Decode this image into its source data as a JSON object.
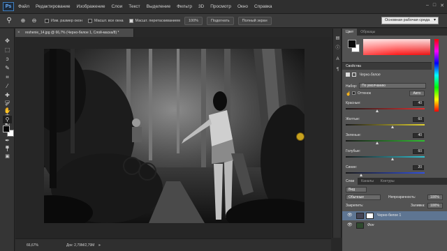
{
  "app": {
    "logo": "Ps",
    "menu": [
      "Файл",
      "Редактирование",
      "Изображение",
      "Слои",
      "Текст",
      "Выделение",
      "Фильтр",
      "3D",
      "Просмотр",
      "Окно",
      "Справка"
    ]
  },
  "window_controls": [
    "–",
    "□",
    "✕"
  ],
  "options_bar": {
    "resize_label": "Изм. размер окон",
    "all_windows_label": "Масшт. все окна",
    "scrubby_label": "Масшт. перетаскиванием",
    "zoom_value": "100%",
    "fit_button": "Подогнать",
    "fill_button": "Полный экран",
    "workspace": "Основная рабочая среда"
  },
  "document": {
    "tab_title": "reshenie_14.jpg @ 66,7% (Черно-белое 1, Слой-маска/8) *",
    "close_glyph": "×",
    "zoom_status": "66,67%",
    "doc_size": "Док: 2,79M/2,79M"
  },
  "panels": {
    "color_tabs": [
      "Цвет",
      "Образцы"
    ],
    "properties": {
      "title": "Свойства",
      "adjustment_name": "Черно-белое",
      "preset_label": "Набор:",
      "preset_value": "По умолчанию",
      "tint_label": "Оттенок",
      "auto_button": "Авто",
      "sliders": [
        {
          "label": "Красные:",
          "value": "40",
          "color": "#e03030"
        },
        {
          "label": "Желтые:",
          "value": "60",
          "color": "#e0d030"
        },
        {
          "label": "Зеленые:",
          "value": "40",
          "color": "#30c030"
        },
        {
          "label": "Голубые:",
          "value": "60",
          "color": "#30c0d0"
        },
        {
          "label": "Синие:",
          "value": "20",
          "color": "#3050e0"
        },
        {
          "label": "Пурпурные:",
          "value": "80",
          "color": "#c030c0"
        }
      ]
    },
    "layers": {
      "tabs": [
        "Слои",
        "Каналы",
        "Контуры"
      ],
      "filter_label": "Вид",
      "blend_mode": "Обычные",
      "opacity_label": "Непрозрачность:",
      "opacity_value": "100%",
      "lock_label": "Закрепить:",
      "fill_label": "Заливка:",
      "fill_value": "100%",
      "items": [
        {
          "name": "Черно-белое 1"
        },
        {
          "name": "Фон"
        }
      ]
    }
  },
  "icons": {
    "eye": "👁",
    "zoom_tool": "🔍",
    "toolbar": [
      "move-icon",
      "marquee-icon",
      "lasso-icon",
      "quick-select-icon",
      "crop-icon",
      "eyedropper-icon",
      "healing-icon",
      "brush-icon",
      "stamp-icon",
      "history-brush-icon",
      "eraser-icon",
      "gradient-icon",
      "blur-icon",
      "dodge-icon",
      "pen-icon",
      "type-icon",
      "path-select-icon",
      "shape-icon",
      "hand-icon",
      "zoom-icon"
    ]
  },
  "colors": {
    "foreground": "#000000",
    "background": "#ffffff",
    "accent": "#5e7592"
  }
}
